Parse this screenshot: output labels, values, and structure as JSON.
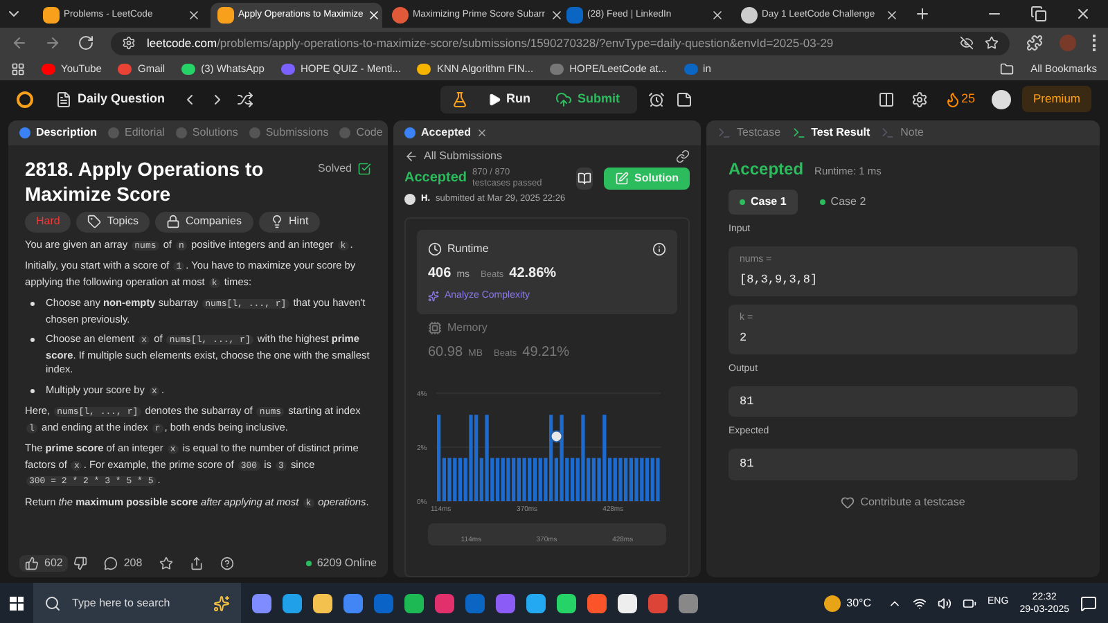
{
  "browser": {
    "tabs": [
      {
        "title": "Problems - LeetCode",
        "selected": false,
        "kind": "leetcode"
      },
      {
        "title": "Apply Operations to Maximize",
        "selected": true,
        "kind": "leetcode"
      },
      {
        "title": "Maximizing Prime Score Subarr",
        "selected": false,
        "kind": "burst"
      },
      {
        "title": "(28) Feed | LinkedIn",
        "selected": false,
        "kind": "linkedin"
      },
      {
        "title": "Day 1 LeetCode Challenge",
        "selected": false,
        "kind": "globe"
      }
    ],
    "url_host": "leetcode.com",
    "url_path": "/problems/apply-operations-to-maximize-score/submissions/1590270328/?envType=daily-question&envId=2025-03-29",
    "bookmarks": [
      {
        "label": "YouTube",
        "color": "#ff0000"
      },
      {
        "label": "Gmail",
        "color": "#ea4335"
      },
      {
        "label": "(3) WhatsApp",
        "color": "#25d366"
      },
      {
        "label": "HOPE QUIZ - Menti...",
        "color": "#7b61ff"
      },
      {
        "label": "KNN Algorithm FIN...",
        "color": "#f4b400"
      },
      {
        "label": "HOPE/LeetCode at...",
        "color": "#777777"
      },
      {
        "label": "in",
        "color": "#0a66c2"
      }
    ],
    "all_bookmarks": "All Bookmarks"
  },
  "header": {
    "title": "Daily Question",
    "run": "Run",
    "submit": "Submit",
    "streak": "25",
    "premium": "Premium"
  },
  "description": {
    "tabs": [
      {
        "label": "Description",
        "selected": true
      },
      {
        "label": "Editorial",
        "selected": false
      },
      {
        "label": "Solutions",
        "selected": false
      },
      {
        "label": "Submissions",
        "selected": false
      },
      {
        "label": "Code",
        "selected": false
      }
    ],
    "title": "2818. Apply Operations to Maximize Score",
    "solved": "Solved",
    "tags": [
      {
        "kind": "difficulty",
        "label": "Hard"
      },
      {
        "kind": "topics",
        "label": "Topics"
      },
      {
        "kind": "companies",
        "label": "Companies"
      },
      {
        "kind": "hint",
        "label": "Hint"
      }
    ],
    "blocks": [
      {
        "kind": "para",
        "segments": [
          {
            "kind": "text",
            "text": "You are given an array "
          },
          {
            "kind": "code",
            "text": "nums"
          },
          {
            "kind": "text",
            "text": " of "
          },
          {
            "kind": "code",
            "text": "n"
          },
          {
            "kind": "text",
            "text": " positive integers and an integer "
          },
          {
            "kind": "code",
            "text": "k"
          },
          {
            "kind": "text",
            "text": "."
          }
        ]
      },
      {
        "kind": "para",
        "segments": [
          {
            "kind": "text",
            "text": "Initially, you start with a score of "
          },
          {
            "kind": "code",
            "text": "1"
          },
          {
            "kind": "text",
            "text": ". You have to maximize your score by applying the following operation at most "
          },
          {
            "kind": "code",
            "text": "k"
          },
          {
            "kind": "text",
            "text": " times:"
          }
        ]
      },
      {
        "kind": "bullet",
        "segments": [
          {
            "kind": "text",
            "text": "Choose any **non-empty** subarray "
          },
          {
            "kind": "code",
            "text": "nums[l, ..., r]"
          },
          {
            "kind": "text",
            "text": " that you haven't chosen previously."
          }
        ]
      },
      {
        "kind": "bullet",
        "segments": [
          {
            "kind": "text",
            "text": "Choose an element "
          },
          {
            "kind": "code",
            "text": "x"
          },
          {
            "kind": "text",
            "text": " of "
          },
          {
            "kind": "code",
            "text": "nums[l, ..., r]"
          },
          {
            "kind": "text",
            "text": " with the highest **prime score**. If multiple such elements exist, choose the one with the smallest index."
          }
        ]
      },
      {
        "kind": "bullet",
        "segments": [
          {
            "kind": "text",
            "text": "Multiply your score by "
          },
          {
            "kind": "code",
            "text": "x"
          },
          {
            "kind": "text",
            "text": "."
          }
        ]
      },
      {
        "kind": "para",
        "segments": [
          {
            "kind": "text",
            "text": "Here, "
          },
          {
            "kind": "code",
            "text": "nums[l, ..., r]"
          },
          {
            "kind": "text",
            "text": " denotes the subarray of "
          },
          {
            "kind": "code",
            "text": "nums"
          },
          {
            "kind": "text",
            "text": " starting at index "
          },
          {
            "kind": "code",
            "text": "l"
          },
          {
            "kind": "text",
            "text": " and ending at the index "
          },
          {
            "kind": "code",
            "text": "r"
          },
          {
            "kind": "text",
            "text": ", both ends being inclusive."
          }
        ]
      },
      {
        "kind": "para",
        "segments": [
          {
            "kind": "text",
            "text": "The **prime score** of an integer "
          },
          {
            "kind": "code",
            "text": "x"
          },
          {
            "kind": "text",
            "text": " is equal to the number of distinct prime factors of "
          },
          {
            "kind": "code",
            "text": "x"
          },
          {
            "kind": "text",
            "text": ". For example, the prime score of "
          },
          {
            "kind": "code",
            "text": "300"
          },
          {
            "kind": "text",
            "text": " is "
          },
          {
            "kind": "code",
            "text": "3"
          },
          {
            "kind": "text",
            "text": " since "
          },
          {
            "kind": "code",
            "text": "300 = 2 * 2 * 3 * 5 * 5"
          },
          {
            "kind": "text",
            "text": "."
          }
        ]
      },
      {
        "kind": "para",
        "segments": [
          {
            "kind": "text",
            "text": "Return *the* **maximum possible score** *after applying at most* "
          },
          {
            "kind": "code",
            "text": "k"
          },
          {
            "kind": "text",
            "text": " *operations*."
          }
        ]
      }
    ],
    "likes": "602",
    "comments": "208",
    "online": "6209 Online"
  },
  "submission": {
    "tab": "Accepted",
    "back": "All Submissions",
    "status": "Accepted",
    "testcases": "870 / 870 testcases passed",
    "user": "H.",
    "submitted": "submitted at Mar 29, 2025 22:26",
    "solution": "Solution",
    "runtime": {
      "label": "Runtime",
      "value": "406",
      "unit": "ms",
      "beats_label": "Beats",
      "beats": "42.86%",
      "analyze": "Analyze Complexity"
    },
    "memory": {
      "label": "Memory",
      "value": "60.98",
      "unit": "MB",
      "beats_label": "Beats",
      "beats": "49.21%"
    },
    "chart_data": {
      "type": "bar",
      "ylim": [
        0,
        4
      ],
      "yticks": [
        {
          "value": 0,
          "label": "0%"
        },
        {
          "value": 2,
          "label": "2%"
        },
        {
          "value": 4,
          "label": "4%"
        }
      ],
      "values": [
        3.2,
        1.6,
        1.6,
        1.6,
        1.6,
        1.6,
        3.2,
        3.2,
        1.6,
        3.2,
        1.6,
        1.6,
        1.6,
        1.6,
        1.6,
        1.6,
        1.6,
        1.6,
        1.6,
        1.6,
        1.6,
        3.2,
        1.6,
        3.2,
        1.6,
        1.6,
        1.6,
        3.2,
        1.6,
        1.6,
        1.6,
        3.2,
        1.6,
        1.6,
        1.6,
        1.6,
        1.6,
        1.6,
        1.6,
        1.6,
        1.6,
        1.6
      ]
    },
    "x_axis_labels": [
      "114ms",
      "370ms",
      "428ms"
    ],
    "brush_labels": [
      "114ms",
      "370ms",
      "428ms"
    ]
  },
  "result": {
    "tabs": [
      {
        "label": "Testcase",
        "selected": false
      },
      {
        "label": "Test Result",
        "selected": true
      },
      {
        "label": "Note",
        "selected": false
      }
    ],
    "status": "Accepted",
    "runtime": "Runtime: 1 ms",
    "cases": [
      {
        "label": "Case 1",
        "selected": true
      },
      {
        "label": "Case 2",
        "selected": false
      }
    ],
    "input_label": "Input",
    "inputs": [
      {
        "name": "nums =",
        "value": "[8,3,9,3,8]"
      },
      {
        "name": "k =",
        "value": "2"
      }
    ],
    "output_label": "Output",
    "output": "81",
    "expected_label": "Expected",
    "expected": "81",
    "contribute": "Contribute a testcase"
  },
  "taskbar": {
    "search": "Type here to search",
    "apps": [
      {
        "color": "#7f8cff"
      },
      {
        "color": "#1fa0e8"
      },
      {
        "color": "#f2c14e"
      },
      {
        "color": "#4285f4"
      },
      {
        "color": "#0a64c8"
      },
      {
        "color": "#1db954"
      },
      {
        "color": "#e1306c"
      },
      {
        "color": "#0a66c2"
      },
      {
        "color": "#8b5cf6"
      },
      {
        "color": "#23a9f2"
      },
      {
        "color": "#25d366"
      },
      {
        "color": "#fb542b"
      },
      {
        "color": "#eeeeee"
      },
      {
        "color": "#db4437"
      },
      {
        "color": "#888888"
      }
    ],
    "weather": "30°C",
    "lang": "ENG",
    "time": "22:32",
    "date": "29-03-2025"
  }
}
